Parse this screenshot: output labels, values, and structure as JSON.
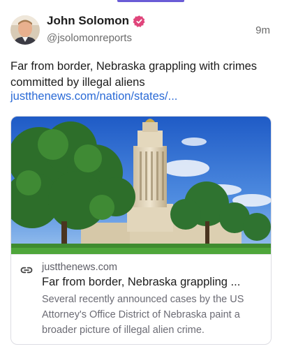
{
  "post": {
    "author_name": "John Solomon",
    "handle": "@jsolomonreports",
    "timestamp": "9m",
    "text": "Far from border, Nebraska grappling with crimes committed by illegal aliens",
    "link_text": "justthenews.com/nation/states/..."
  },
  "link_card": {
    "domain": "justthenews.com",
    "title": "Far from border, Nebraska grappling ...",
    "description": "Several recently announced cases by the US Attorney's Office District of Nebraska paint a broader picture of illegal alien crime."
  },
  "colors": {
    "accent": "#6a5cd6",
    "link": "#2a6ad6",
    "verified_badge": "#e0457b"
  },
  "icons": {
    "verified": "verified-badge-icon",
    "link": "link-icon"
  }
}
